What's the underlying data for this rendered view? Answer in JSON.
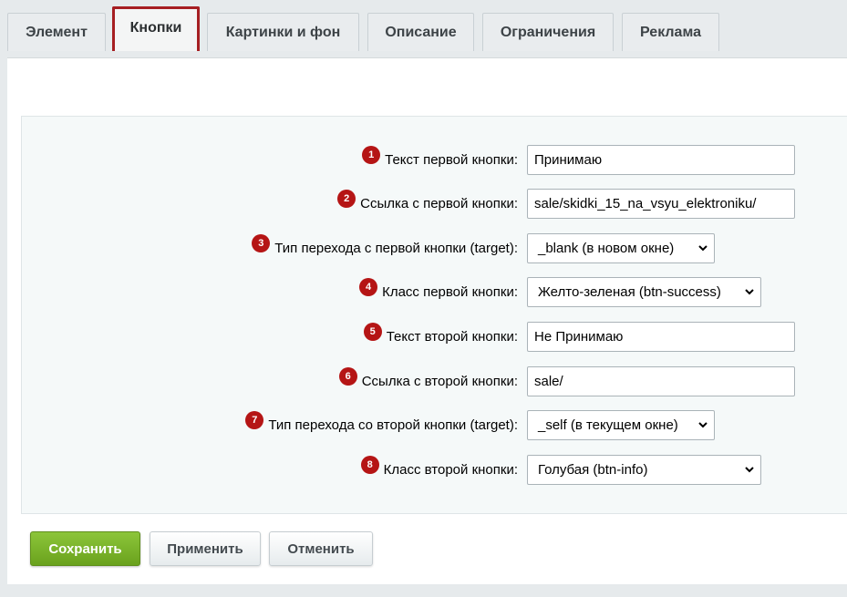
{
  "tabs": [
    {
      "label": "Элемент"
    },
    {
      "label": "Кнопки"
    },
    {
      "label": "Картинки и фон"
    },
    {
      "label": "Описание"
    },
    {
      "label": "Ограничения"
    },
    {
      "label": "Реклама"
    }
  ],
  "fields": [
    {
      "num": "1",
      "label": "Текст первой кнопки:",
      "value": "Принимаю"
    },
    {
      "num": "2",
      "label": "Ссылка с первой кнопки:",
      "value": "sale/skidki_15_na_vsyu_elektroniku/"
    },
    {
      "num": "3",
      "label": "Тип перехода с первой кнопки (target):",
      "value": "_blank (в новом окне)"
    },
    {
      "num": "4",
      "label": "Класс первой кнопки:",
      "value": "Желто-зеленая (btn-success)"
    },
    {
      "num": "5",
      "label": "Текст второй кнопки:",
      "value": "Не Принимаю"
    },
    {
      "num": "6",
      "label": "Ссылка с второй кнопки:",
      "value": "sale/"
    },
    {
      "num": "7",
      "label": "Тип перехода со второй кнопки (target):",
      "value": "_self (в текущем окне)"
    },
    {
      "num": "8",
      "label": "Класс второй кнопки:",
      "value": "Голубая (btn-info)"
    }
  ],
  "buttons": {
    "save": "Сохранить",
    "apply": "Применить",
    "cancel": "Отменить"
  },
  "colors": {
    "active_tab_border": "#a61e22",
    "badge": "#b51515",
    "save_button": "#7ab32b"
  }
}
